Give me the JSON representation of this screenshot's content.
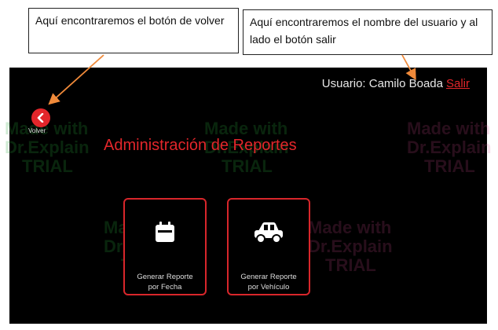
{
  "callouts": {
    "left": "Aquí encontraremos el botón de volver",
    "right": "Aquí encontraremos el nombre del usuario y al lado el botón salir"
  },
  "header": {
    "user_label": "Usuario: Camilo Boada",
    "logout_label": "Salir"
  },
  "nav": {
    "back_label": "Volver"
  },
  "main": {
    "title": "Administración de Reportes",
    "cards": [
      {
        "label_line1": "Generar Reporte",
        "label_line2": "por Fecha",
        "icon": "calendar-icon"
      },
      {
        "label_line1": "Generar Reporte",
        "label_line2": "por Vehículo",
        "icon": "car-icon"
      }
    ]
  },
  "watermark": {
    "line1": "Made with",
    "line2": "Dr.Explain",
    "line3": "TRIAL"
  },
  "colors": {
    "accent": "#e3262b",
    "annotation_arrow": "#f08a3a",
    "screen_bg": "#000000"
  }
}
